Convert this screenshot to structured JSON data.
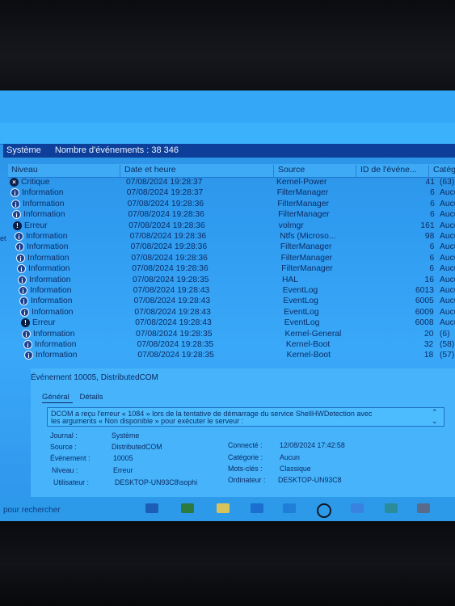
{
  "header": {
    "log_name": "Système",
    "events_label": "Nombre d'événements : 38 346"
  },
  "columns": {
    "niveau": "Niveau",
    "date": "Date et heure",
    "source": "Source",
    "id": "ID de l'événe...",
    "categorie": "Catég"
  },
  "events": [
    {
      "level": "Critique",
      "type": "crit",
      "date": "07/08/2024 19:28:37",
      "source": "Kernel-Power",
      "id": "41",
      "cat": "(63)"
    },
    {
      "level": "Information",
      "type": "info",
      "date": "07/08/2024 19:28:37",
      "source": "FilterManager",
      "id": "6",
      "cat": "Aucun"
    },
    {
      "level": "Information",
      "type": "info",
      "date": "07/08/2024 19:28:36",
      "source": "FilterManager",
      "id": "6",
      "cat": "Aucun"
    },
    {
      "level": "Information",
      "type": "info",
      "date": "07/08/2024 19:28:36",
      "source": "FilterManager",
      "id": "6",
      "cat": "Aucun"
    },
    {
      "level": "Erreur",
      "type": "err",
      "date": "07/08/2024 19:28:36",
      "source": "volmgr",
      "id": "161",
      "cat": "Aucun"
    },
    {
      "level": "Information",
      "type": "info",
      "date": "07/08/2024 19:28:36",
      "source": "Ntfs (Microso...",
      "id": "98",
      "cat": "Aucun"
    },
    {
      "level": "Information",
      "type": "info",
      "date": "07/08/2024 19:28:36",
      "source": "FilterManager",
      "id": "6",
      "cat": "Aucun"
    },
    {
      "level": "Information",
      "type": "info",
      "date": "07/08/2024 19:28:36",
      "source": "FilterManager",
      "id": "6",
      "cat": "Aucun"
    },
    {
      "level": "Information",
      "type": "info",
      "date": "07/08/2024 19:28:36",
      "source": "FilterManager",
      "id": "6",
      "cat": "Aucun"
    },
    {
      "level": "Information",
      "type": "info",
      "date": "07/08/2024 19:28:35",
      "source": "HAL",
      "id": "16",
      "cat": "Aucun"
    },
    {
      "level": "Information",
      "type": "info",
      "date": "07/08/2024 19:28:43",
      "source": "EventLog",
      "id": "6013",
      "cat": "Aucun"
    },
    {
      "level": "Information",
      "type": "info",
      "date": "07/08/2024 19:28:43",
      "source": "EventLog",
      "id": "6005",
      "cat": "Aucun"
    },
    {
      "level": "Information",
      "type": "info",
      "date": "07/08/2024 19:28:43",
      "source": "EventLog",
      "id": "6009",
      "cat": "Aucun"
    },
    {
      "level": "Erreur",
      "type": "err",
      "date": "07/08/2024 19:28:43",
      "source": "EventLog",
      "id": "6008",
      "cat": "Aucun"
    },
    {
      "level": "Information",
      "type": "info",
      "date": "07/08/2024 19:28:35",
      "source": "Kernel-General",
      "id": "20",
      "cat": "(6)"
    },
    {
      "level": "Information",
      "type": "info",
      "date": "07/08/2024 19:28:35",
      "source": "Kernel-Boot",
      "id": "32",
      "cat": "(58)"
    },
    {
      "level": "Information",
      "type": "info",
      "date": "07/08/2024 19:28:35",
      "source": "Kernel-Boot",
      "id": "18",
      "cat": "(57)"
    }
  ],
  "detail": {
    "title": "Événement 10005, DistributedCOM",
    "tab_general": "Général",
    "tab_details": "Détails",
    "message_line1": "DCOM a reçu l'erreur « 1084 » lors de la tentative de démarrage du service ShellHWDetection avec",
    "message_line2": "les arguments « Non disponible » pour exécuter le serveur :",
    "journal_label": "Journal :",
    "journal_value": "Système",
    "source_label": "Source :",
    "source_value": "DistributedCOM",
    "event_label": "Événement :",
    "event_value": "10005",
    "level_label": "Niveau :",
    "level_value": "Erreur",
    "user_label": "Utilisateur :",
    "user_value": "DESKTOP-UN93C8\\sophi",
    "logged_label": "Connecté :",
    "logged_value": "12/08/2024 17:42:58",
    "category_label": "Catégorie :",
    "category_value": "Aucun",
    "keywords_label": "Mots-clés :",
    "keywords_value": "Classique",
    "computer_label": "Ordinateur :",
    "computer_value": "DESKTOP-UN93C8"
  },
  "taskbar": {
    "search_placeholder": "pour rechercher"
  },
  "left_edge_text": "et"
}
